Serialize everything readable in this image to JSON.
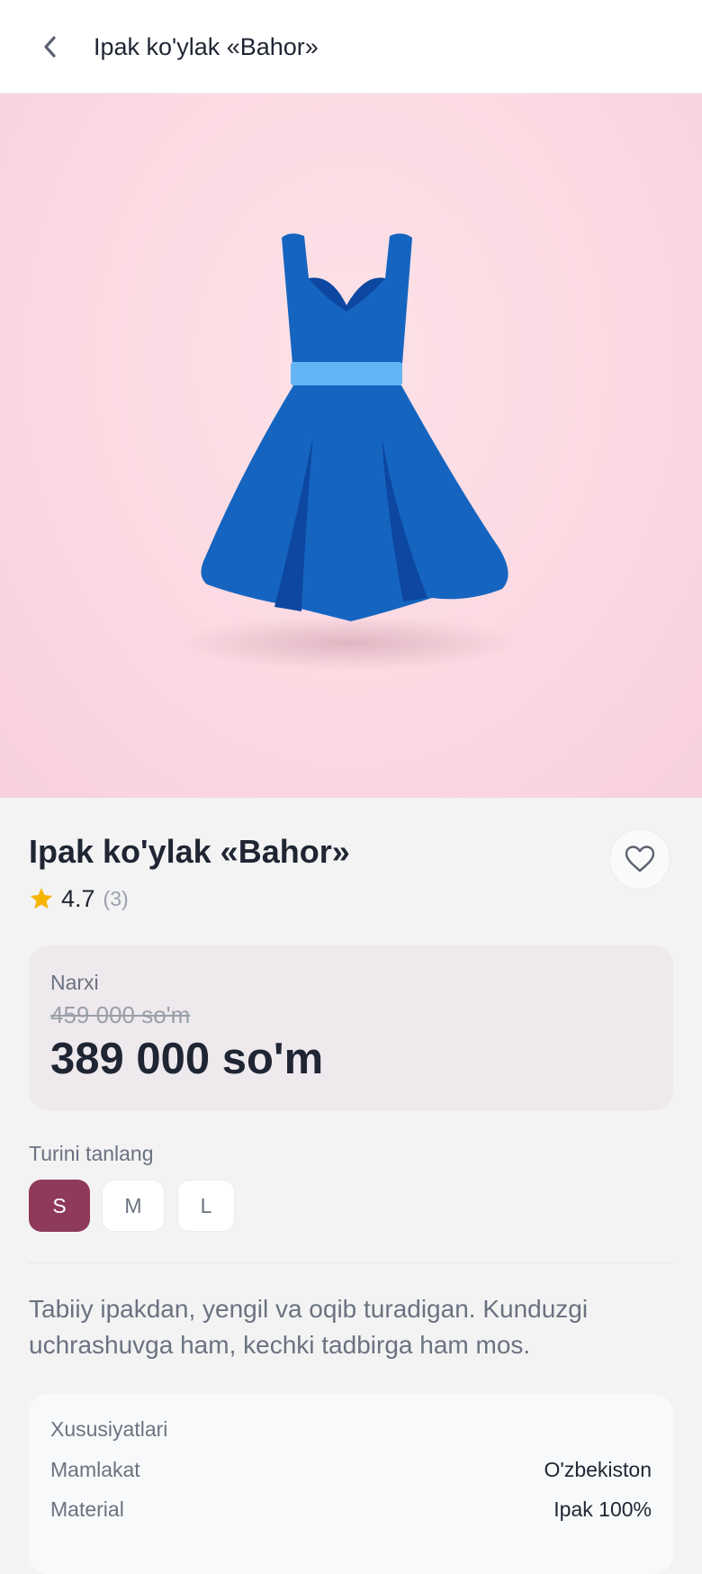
{
  "header": {
    "title": "Ipak ko'ylak «Bahor»",
    "back_icon": "chevron-left-icon"
  },
  "hero": {
    "image": "blue-dress-illustration",
    "colors": {
      "background": "#fbd9e2",
      "dress": "#1565c0",
      "belt": "#64b5f6"
    }
  },
  "product": {
    "title": "Ipak ko'ylak «Bahor»",
    "favorite_icon": "heart-outline-icon",
    "rating": {
      "value": "4.7",
      "count": "(3)",
      "icon": "star-icon"
    }
  },
  "price": {
    "label": "Narxi",
    "old_price": "459 000 so'm",
    "new_price": "389 000 so'm"
  },
  "variants": {
    "label": "Turini tanlang",
    "options": [
      "S",
      "M",
      "L"
    ],
    "selected": "S",
    "accent": "#8f3a5a"
  },
  "description": "Tabiiy ipakdan, yengil va oqib turadigan. Kunduzgi uchrashuvga ham, kechki tadbirga ham mos.",
  "specs": {
    "title": "Xususiyatlari",
    "rows": [
      {
        "key": "Mamlakat",
        "value": "O'zbekiston"
      },
      {
        "key": "Material",
        "value": "Ipak 100%"
      }
    ]
  }
}
